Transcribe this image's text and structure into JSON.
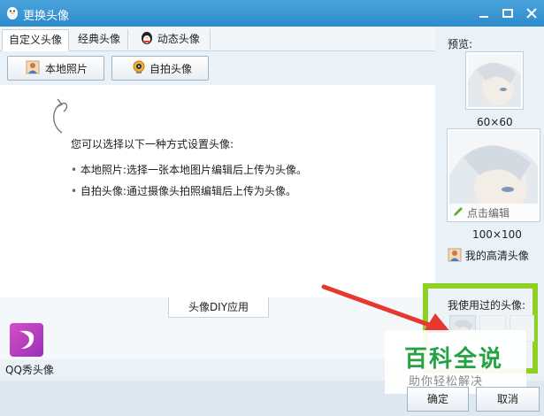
{
  "window": {
    "title": "更换头像"
  },
  "tabs": [
    {
      "label": "自定义头像"
    },
    {
      "label": "经典头像"
    },
    {
      "label": "动态头像"
    }
  ],
  "buttons": {
    "local_photo": "本地照片",
    "selfie": "自拍头像"
  },
  "content": {
    "intro": "您可以选择以下一种方式设置头像:",
    "bullets": [
      "本地照片:选择一张本地图片编辑后上传为头像。",
      "自拍头像:通过摄像头拍照编辑后上传为头像。"
    ]
  },
  "diy": {
    "tab_label": "头像DIY应用",
    "app_label": "QQ秀头像"
  },
  "preview": {
    "label": "预览:",
    "small_size": "60×60",
    "large_size": "100×100",
    "edit_label": "点击编辑",
    "hd_label": "我的高清头像"
  },
  "history": {
    "label": "我使用过的头像:"
  },
  "watermark": {
    "title": "百科全说",
    "subtitle": "助你轻松解决"
  },
  "footer": {
    "ok": "确定",
    "cancel": "取消"
  },
  "colors": {
    "titlebar": "#2d8bcc",
    "highlight_frame": "#8fd024",
    "arrow": "#e5392f"
  }
}
